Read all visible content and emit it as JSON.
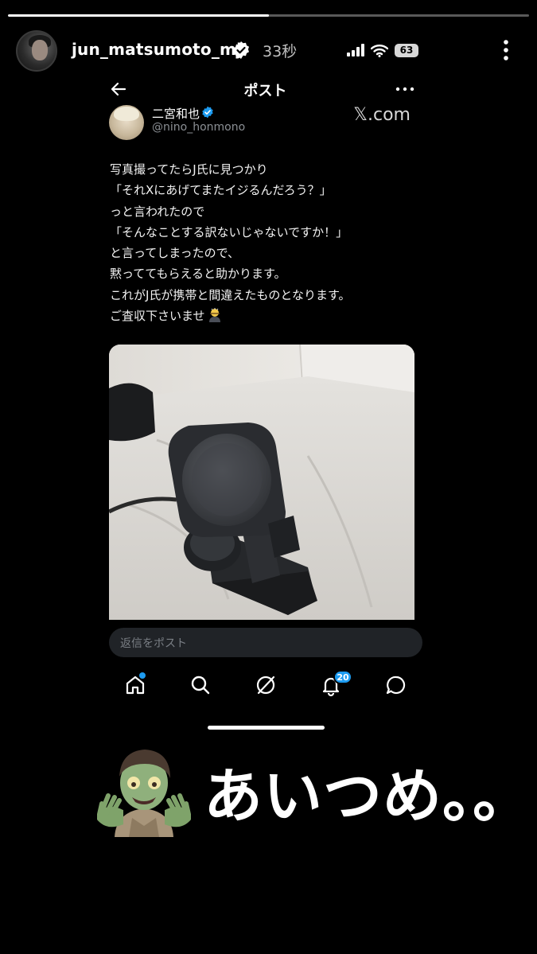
{
  "story": {
    "progress_fraction": 0.5,
    "username": "jun_matsumoto_mj",
    "time": "33秒",
    "battery": "63"
  },
  "x_post": {
    "title": "ポスト",
    "author_name": "二宮和也",
    "author_handle": "@nino_honmono",
    "brand": "𝕏.com",
    "lines": [
      "写真撮ってたらJ氏に見つかり",
      "「それXにあげてまたイジるんだろう？」",
      "っと言われたので",
      "「そんなことする訳ないじゃないですか！」",
      "と言ってしまったので、",
      "黙っててもらえると助かります。",
      "これがJ氏が携帯と間違えたものとなります。",
      "ご査収下さいませ"
    ],
    "reply_placeholder": "返信をポスト",
    "notification_count": "20"
  },
  "caption": {
    "text": "あいつめ。。"
  },
  "colors": {
    "x_blue": "#1d9bf0",
    "background": "#000000"
  },
  "icons": [
    "more-vertical-icon",
    "back-arrow-icon",
    "more-horizontal-icon",
    "home-icon",
    "search-icon",
    "grok-icon",
    "bell-icon",
    "messages-icon",
    "zombie-emoji",
    "bowing-emoji"
  ]
}
